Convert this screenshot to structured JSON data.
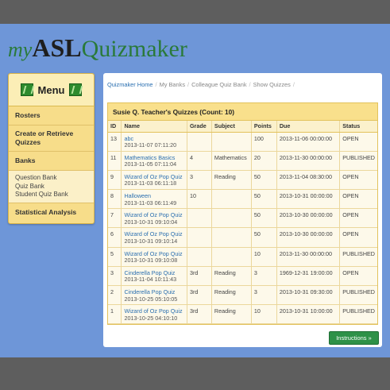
{
  "logo": {
    "my": "my",
    "asl": "ASL",
    "quizmaker": "Quizmaker"
  },
  "sidebar": {
    "menu_title": "Menu",
    "items": [
      {
        "label": "Rosters"
      },
      {
        "label": "Create or Retrieve Quizzes"
      },
      {
        "label": "Banks"
      }
    ],
    "bank_links": [
      "Question Bank",
      "Quiz Bank",
      "Student Quiz Bank"
    ],
    "stats_label": "Statistical Analysis"
  },
  "breadcrumb": [
    "Quizmaker Home",
    "My Banks",
    "Colleague Quiz Bank",
    "Show Quizzes"
  ],
  "quizzes": {
    "title": "Susie Q. Teacher's Quizzes (Count: 10)",
    "columns": [
      "ID",
      "Name",
      "Grade",
      "Subject",
      "Points",
      "Due",
      "Status"
    ],
    "rows": [
      {
        "id": "13",
        "name": "abc",
        "created": "2013-11-07 07:11:20",
        "grade": "",
        "subject": "",
        "points": "100",
        "due": "2013-11-06 00:00:00",
        "status": "OPEN"
      },
      {
        "id": "11",
        "name": "Mathematics Basics",
        "created": "2013-11-05 07:11:04",
        "grade": "4",
        "subject": "Mathematics",
        "points": "20",
        "due": "2013-11-30 00:00:00",
        "status": "PUBLISHED"
      },
      {
        "id": "9",
        "name": "Wizard of Oz Pop Quiz",
        "created": "2013-11-03 06:11:18",
        "grade": "3",
        "subject": "Reading",
        "points": "50",
        "due": "2013-11-04 08:30:00",
        "status": "OPEN"
      },
      {
        "id": "8",
        "name": "Halloween",
        "created": "2013-11-03 06:11:49",
        "grade": "10",
        "subject": "",
        "points": "50",
        "due": "2013-10-31 00:00:00",
        "status": "OPEN"
      },
      {
        "id": "7",
        "name": "Wizard of Oz Pop Quiz",
        "created": "2013-10-31 09:10:04",
        "grade": "",
        "subject": "",
        "points": "50",
        "due": "2013-10-30 00:00:00",
        "status": "OPEN"
      },
      {
        "id": "6",
        "name": "Wizard of Oz Pop Quiz",
        "created": "2013-10-31 09:10:14",
        "grade": "",
        "subject": "",
        "points": "50",
        "due": "2013-10-30 00:00:00",
        "status": "OPEN"
      },
      {
        "id": "5",
        "name": "Wizard of Oz Pop Quiz",
        "created": "2013-10-31 09:10:08",
        "grade": "",
        "subject": "",
        "points": "10",
        "due": "2013-11-30 00:00:00",
        "status": "PUBLISHED"
      },
      {
        "id": "3",
        "name": "Cinderella Pop Quiz",
        "created": "2013-11-04 10:11:43",
        "grade": "3rd",
        "subject": "Reading",
        "points": "3",
        "due": "1969-12-31 19:00:00",
        "status": "OPEN"
      },
      {
        "id": "2",
        "name": "Cinderella Pop Quiz",
        "created": "2013-10-25 05:10:05",
        "grade": "3rd",
        "subject": "Reading",
        "points": "3",
        "due": "2013-10-31 09:30:00",
        "status": "PUBLISHED"
      },
      {
        "id": "1",
        "name": "Wizard of Oz Pop Quiz",
        "created": "2013-10-25 04:10:10",
        "grade": "3rd",
        "subject": "Reading",
        "points": "10",
        "due": "2013-10-31 10:00:00",
        "status": "PUBLISHED"
      }
    ]
  },
  "instructions_label": "Instructions »",
  "colors": {
    "background_blue": "#6e96d8",
    "sidebar_yellow": "#f7dd8a",
    "link_blue": "#2a6fb0",
    "button_green": "#2e9148"
  },
  "icons": {
    "menu_left": "grass-icon",
    "menu_right": "grass-icon"
  }
}
